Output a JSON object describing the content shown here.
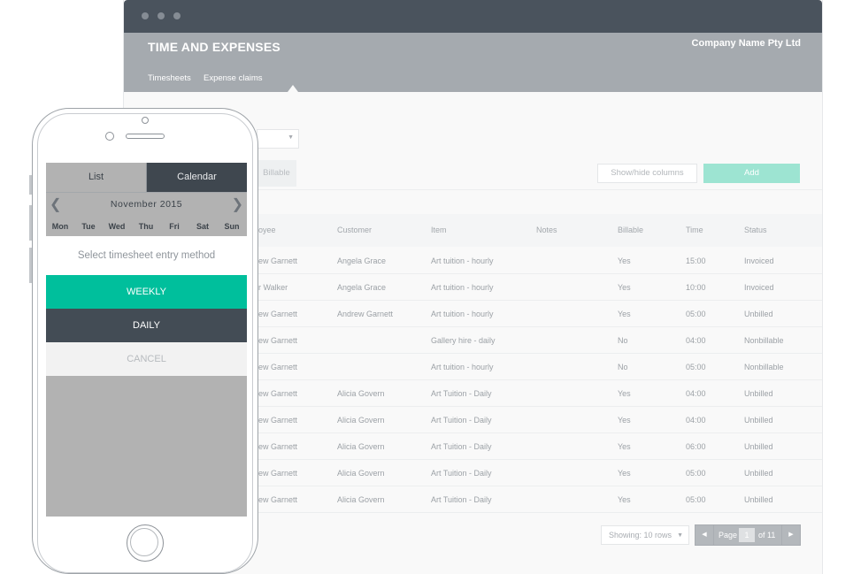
{
  "app": {
    "title": "TIME AND EXPENSES",
    "company": "Company Name Pty Ltd",
    "tabs": [
      "Timesheets",
      "Expense claims"
    ]
  },
  "toolbar": {
    "billable_label": "Billable",
    "showhide_label": "Show/hide columns",
    "add_label": "Add"
  },
  "table": {
    "headers": [
      "oyee",
      "Customer",
      "Item",
      "Notes",
      "Billable",
      "Time",
      "Status"
    ],
    "rows": [
      [
        "ew Garnett",
        "Angela Grace",
        "Art tuition - hourly",
        "",
        "Yes",
        "15:00",
        "Invoiced"
      ],
      [
        "r Walker",
        "Angela Grace",
        "Art tuition - hourly",
        "",
        "Yes",
        "10:00",
        "Invoiced"
      ],
      [
        "ew Garnett",
        "Andrew Garnett",
        "Art tuition - hourly",
        "",
        "Yes",
        "05:00",
        "Unbilled"
      ],
      [
        "ew Garnett",
        "",
        "Gallery hire - daily",
        "",
        "No",
        "04:00",
        "Nonbillable"
      ],
      [
        "ew Garnett",
        "",
        "Art tuition - hourly",
        "",
        "No",
        "05:00",
        "Nonbillable"
      ],
      [
        "ew Garnett",
        "Alicia Govern",
        "Art Tuition - Daily",
        "",
        "Yes",
        "04:00",
        "Unbilled"
      ],
      [
        "ew Garnett",
        "Alicia Govern",
        "Art Tuition - Daily",
        "",
        "Yes",
        "04:00",
        "Unbilled"
      ],
      [
        "ew Garnett",
        "Alicia Govern",
        "Art Tuition - Daily",
        "",
        "Yes",
        "06:00",
        "Unbilled"
      ],
      [
        "ew Garnett",
        "Alicia Govern",
        "Art Tuition - Daily",
        "",
        "Yes",
        "05:00",
        "Unbilled"
      ],
      [
        "ew Garnett",
        "Alicia Govern",
        "Art Tuition - Daily",
        "",
        "Yes",
        "05:00",
        "Unbilled"
      ]
    ]
  },
  "pagination": {
    "showing": "Showing: 10 rows",
    "page_label": "Page",
    "page": "1",
    "of_label": "of 11"
  },
  "phone": {
    "segments": [
      "List",
      "Calendar"
    ],
    "month": "November 2015",
    "weekdays": [
      "Mon",
      "Tue",
      "Wed",
      "Thu",
      "Fri",
      "Sat",
      "Sun"
    ],
    "sheet_title": "Select timesheet entry method",
    "options": [
      "WEEKLY",
      "DAILY",
      "CANCEL"
    ]
  },
  "colors": {
    "accent": "#00bf9c",
    "dark": "#434c55",
    "header": "#a5aaaf",
    "titlebar": "#4a535d"
  }
}
